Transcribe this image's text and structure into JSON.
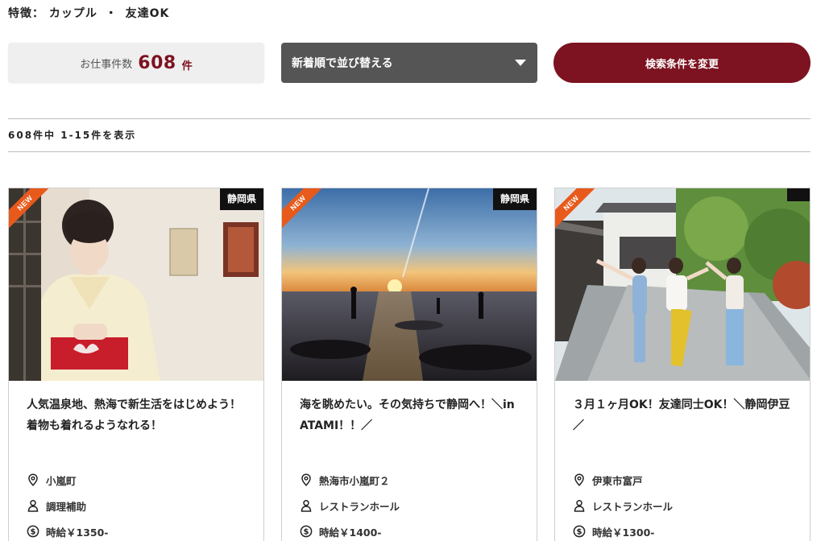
{
  "filters": {
    "label": "特徴：",
    "separator": "・",
    "items": [
      "カップル",
      "友達OK"
    ]
  },
  "summary": {
    "count_label": "お仕事件数",
    "count_value": "608",
    "count_unit": "件"
  },
  "sort": {
    "selected": "新着順で並び替える"
  },
  "change_button_label": "検索条件を変更",
  "results_text": "608件中 1-15件を表示",
  "jobs": [
    {
      "badge": "NEW",
      "prefecture": "静岡県",
      "title": "人気温泉地、熱海で新生活をはじめよう！着物も着れるようなれる！",
      "location": "小嵐町",
      "position": "調理補助",
      "wage": "時給￥1350-",
      "location_icon": "location-pin-icon",
      "position_icon": "person-icon",
      "wage_icon": "dollar-coin-icon"
    },
    {
      "badge": "NEW",
      "prefecture": "静岡県",
      "title": "海を眺めたい。その気持ちで静岡へ！＼in ATAMI！！／",
      "location": "熱海市小嵐町２",
      "position": "レストランホール",
      "wage": "時給￥1400-",
      "location_icon": "location-pin-icon",
      "position_icon": "person-icon",
      "wage_icon": "dollar-coin-icon"
    },
    {
      "badge": "NEW",
      "prefecture": "",
      "title": "３月１ヶ月OK！友達同士OK！＼静岡伊豆／",
      "location": "伊東市富戸",
      "position": "レストランホール",
      "wage": "時給￥1300-",
      "location_icon": "location-pin-icon",
      "position_icon": "person-icon",
      "wage_icon": "dollar-coin-icon"
    }
  ],
  "colors": {
    "brand": "#7d1220",
    "sort_bg": "#555555",
    "count_bg": "#efefef",
    "new_badge": "#e85a1b",
    "tag_bg": "#111111"
  }
}
